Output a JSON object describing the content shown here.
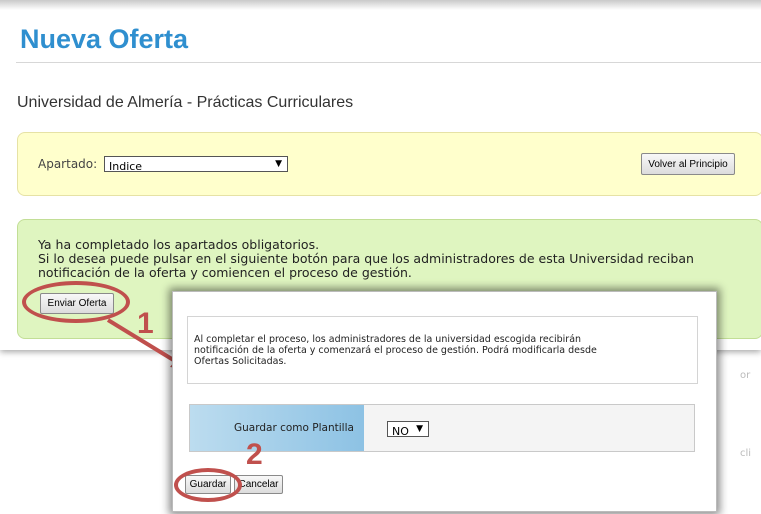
{
  "page": {
    "title": "Nueva Oferta",
    "subtitle": "Universidad de Almería - Prácticas Curriculares"
  },
  "apartado": {
    "label": "Apartado:",
    "selected": "Indice",
    "back_button": "Volver al Principio"
  },
  "notice": {
    "line1": "Ya ha completado los apartados obligatorios.",
    "line2": "Si lo desea puede pulsar en el siguiente botón para que los administradores de esta Universidad reciban",
    "line3": "notificación de la oferta y comiencen el proceso de gestión.",
    "send_button": "Enviar Oferta"
  },
  "dialog": {
    "info_line1": "Al completar el proceso, los administradores de la universidad escogida recibirán",
    "info_line2": "notificación de la oferta y comenzará el proceso de gestión. Podrá modificarla desde",
    "info_line3": "Ofertas Solicitadas.",
    "template_label": "Guardar como Plantilla",
    "template_value": "NO",
    "save_button": "Guardar",
    "cancel_button": "Cancelar"
  },
  "annotations": {
    "step1": "1",
    "step2": "2",
    "color": "#c0504d"
  }
}
